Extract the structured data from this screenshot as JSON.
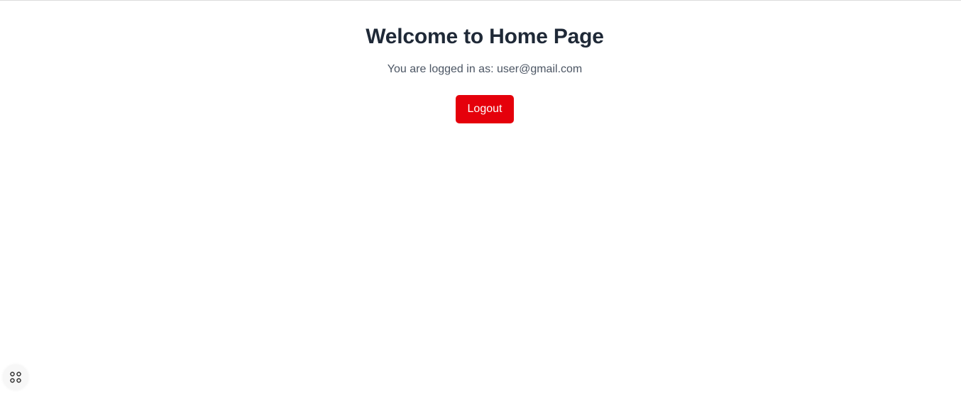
{
  "page": {
    "title": "Welcome to Home Page",
    "logged_in_text": "You are logged in as: user@gmail.com"
  },
  "actions": {
    "logout_label": "Logout"
  },
  "floating_widget": {
    "icon": "grid-icon"
  },
  "colors": {
    "primary_danger": "#e5000b",
    "heading": "#1f2937",
    "body_text": "#4b5563",
    "background": "#ffffff",
    "top_border": "#dcdcdc"
  }
}
